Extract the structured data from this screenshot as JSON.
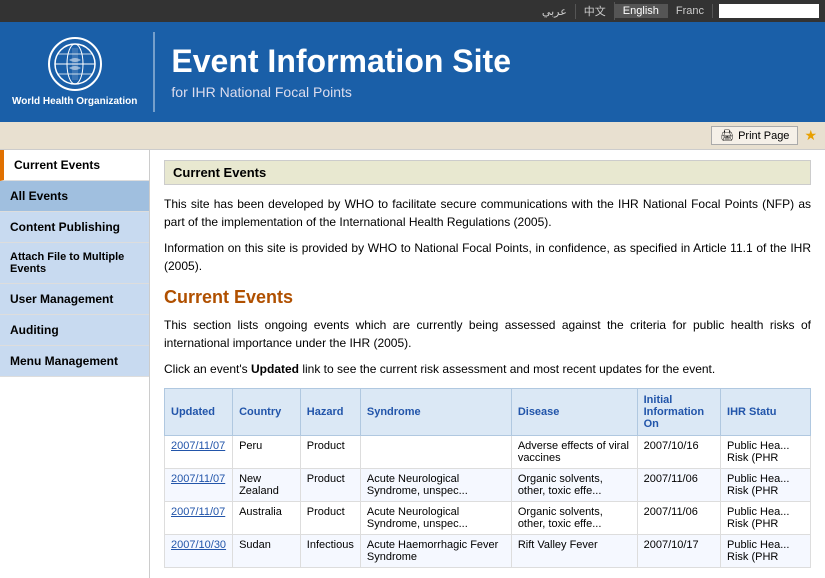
{
  "langBar": {
    "languages": [
      {
        "label": "عربي",
        "active": false
      },
      {
        "label": "中文",
        "active": false
      },
      {
        "label": "English",
        "active": true
      },
      {
        "label": "Franc",
        "active": false
      }
    ],
    "searchPlaceholder": ""
  },
  "header": {
    "logoText": "World Health Organization",
    "siteTitle": "Event Information Site",
    "siteSubtitle": "for IHR National Focal Points"
  },
  "printBar": {
    "printLabel": "Print Page"
  },
  "sidebar": {
    "items": [
      {
        "label": "Current Events",
        "active": true,
        "highlight": false
      },
      {
        "label": "All Events",
        "active": false,
        "highlight": true
      },
      {
        "label": "Content Publishing",
        "active": false,
        "highlight": false
      },
      {
        "label": "Attach File to Multiple Events",
        "active": false,
        "highlight": false
      },
      {
        "label": "User Management",
        "active": false,
        "highlight": false
      },
      {
        "label": "Auditing",
        "active": false,
        "highlight": false
      },
      {
        "label": "Menu Management",
        "active": false,
        "highlight": false
      }
    ]
  },
  "content": {
    "pageTitle": "Current Events",
    "intro1": "This site has been developed by WHO to facilitate secure communications with the IHR National Focal Points (NFP) as part of the implementation of the International Health Regulations (2005).",
    "intro2": "Information on this site is provided by WHO to National Focal Points, in confidence, as specified in Article 11.1 of the IHR (2005).",
    "sectionHeading": "Current Events",
    "desc1": "This section lists ongoing events which are currently being assessed against the criteria for public health risks of international importance under the IHR (2005).",
    "desc2": "Click an event's",
    "desc2bold": "Updated",
    "desc2rest": "link to see the current risk assessment and most recent updates for the event.",
    "table": {
      "headers": [
        "Updated",
        "Country",
        "Hazard",
        "Syndrome",
        "Disease",
        "Initial Information On",
        "IHR Statu"
      ],
      "rows": [
        {
          "updated": "2007/11/07",
          "country": "Peru",
          "hazard": "Product",
          "syndrome": "",
          "disease": "Adverse effects of viral vaccines",
          "initialInfo": "2007/10/16",
          "ihrStatus": "Public Hea... Risk (PHR"
        },
        {
          "updated": "2007/11/07",
          "country": "New Zealand",
          "hazard": "Product",
          "syndrome": "Acute Neurological Syndrome, unspec...",
          "disease": "Organic solvents, other, toxic effe...",
          "initialInfo": "2007/11/06",
          "ihrStatus": "Public Hea... Risk (PHR"
        },
        {
          "updated": "2007/11/07",
          "country": "Australia",
          "hazard": "Product",
          "syndrome": "Acute Neurological Syndrome, unspec...",
          "disease": "Organic solvents, other, toxic effe...",
          "initialInfo": "2007/11/06",
          "ihrStatus": "Public Hea... Risk (PHR"
        },
        {
          "updated": "2007/10/30",
          "country": "Sudan",
          "hazard": "Infectious",
          "syndrome": "Acute Haemorrhagic Fever Syndrome",
          "disease": "Rift Valley Fever",
          "initialInfo": "2007/10/17",
          "ihrStatus": "Public Hea... Risk (PHR"
        }
      ]
    }
  }
}
